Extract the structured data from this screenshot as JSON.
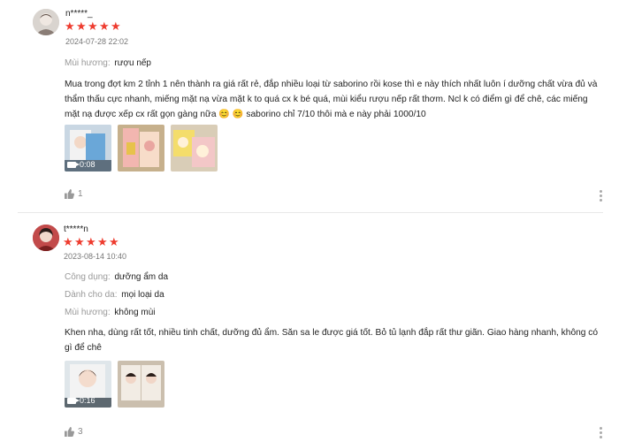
{
  "colors": {
    "star": "#ee3c2f",
    "label": "#999999",
    "text": "#222222",
    "muted": "#777777"
  },
  "reviews": [
    {
      "username": "n*****_",
      "rating": 5,
      "date": "2024-07-28 22:02",
      "attributes": [
        {
          "label": "Mùi hương:",
          "value": "rượu nếp"
        }
      ],
      "text": "Mua trong đợt km 2 tỉnh 1 nên thành ra giá rất rẻ, đắp nhiều loại từ saborino rồi kose thì e này thích nhất luôn í dưỡng chất vừa đủ và thẩm thấu cực nhanh, miếng mặt nạ vừa mặt k to quá cx k bé quá, mùi kiểu rượu nếp rất thơm. Ncl k có điểm gì để chê, các miếng mặt nạ được xếp cx rất gọn gàng nữa 😊 😊 saborino chỉ 7/10 thôi mà e này phải 1000/10",
      "media": [
        {
          "type": "video",
          "duration": "0:08"
        },
        {
          "type": "image"
        },
        {
          "type": "image"
        }
      ],
      "likes": "1"
    },
    {
      "username": "t*****n",
      "rating": 5,
      "date": "2023-08-14 10:40",
      "attributes": [
        {
          "label": "Công dụng:",
          "value": "dưỡng ẩm da"
        },
        {
          "label": "Dành cho da:",
          "value": "mọi loại da"
        },
        {
          "label": "Mùi hương:",
          "value": "không mùi"
        }
      ],
      "text": "Khen nha, dùng rất tốt, nhiều tinh chất, dưỡng đủ ẩm. Săn sa le được giá tốt. Bỏ tủ lạnh đắp rất thư giãn. Giao hàng nhanh, không có gì để chê",
      "media": [
        {
          "type": "video",
          "duration": "0:16"
        },
        {
          "type": "image"
        }
      ],
      "likes": "3"
    }
  ]
}
